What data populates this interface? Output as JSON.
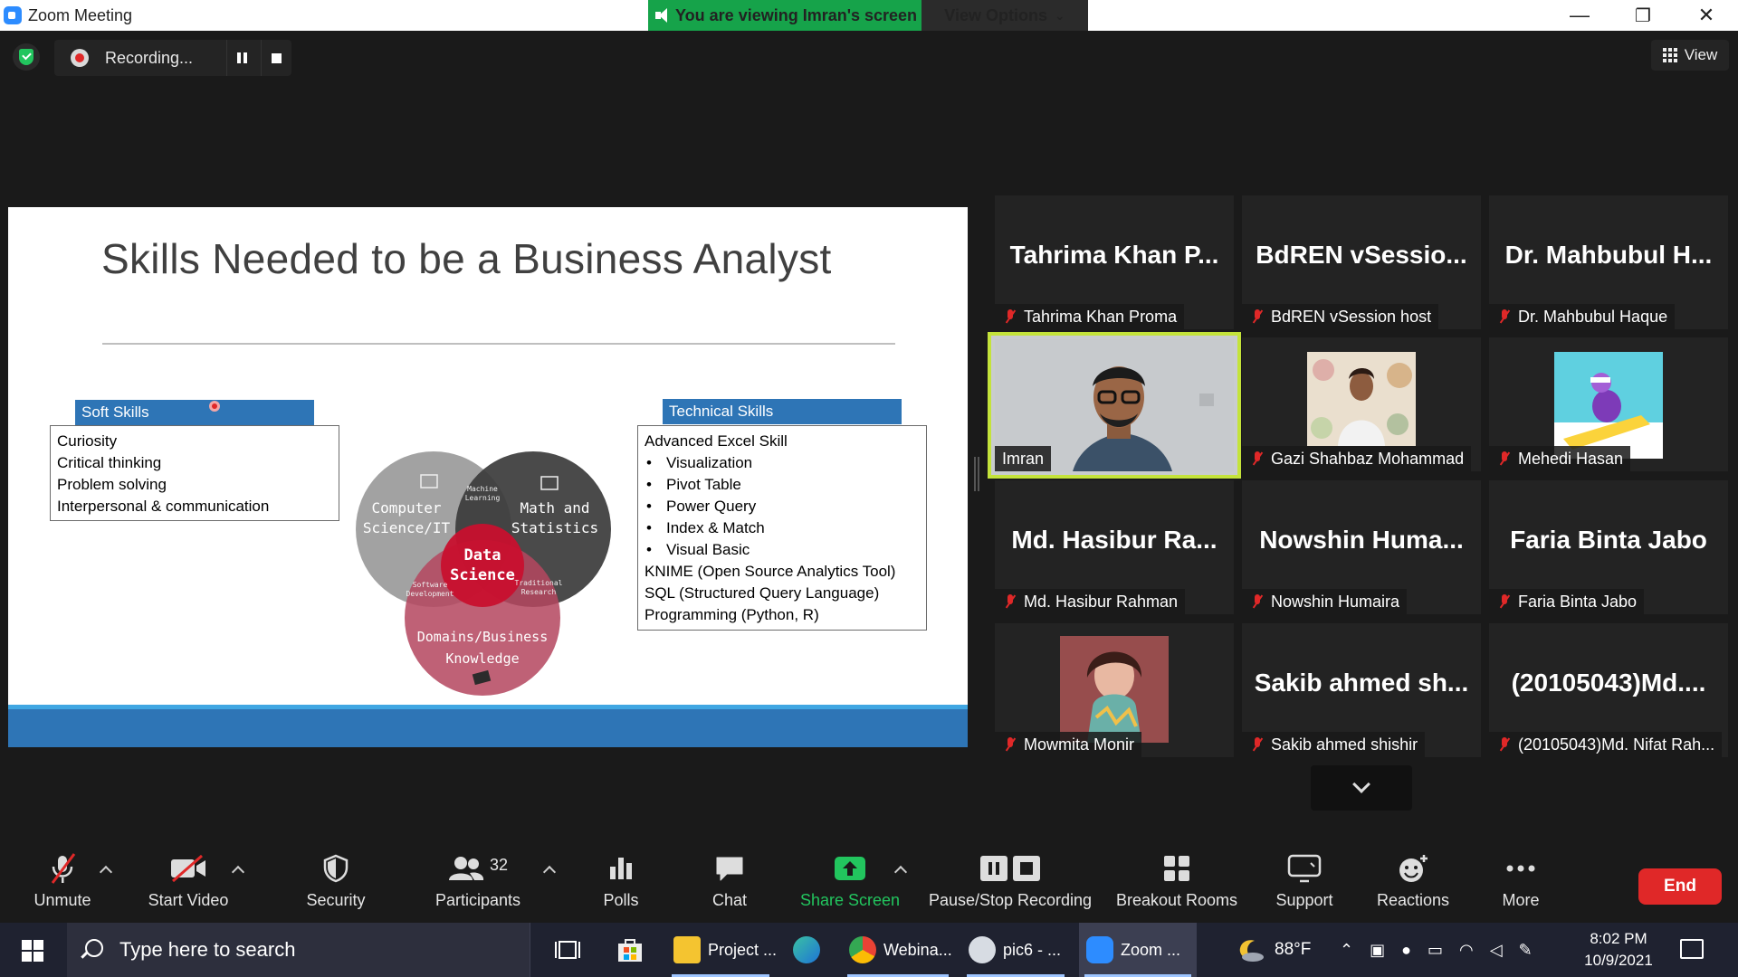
{
  "window": {
    "title": "Zoom Meeting",
    "viewing_banner": "You are viewing Imran's screen",
    "view_options": "View Options",
    "minimize": "—",
    "restore": "❐",
    "close": "✕"
  },
  "recording": {
    "status": "Recording..."
  },
  "view_button": "View",
  "slide": {
    "title": "Skills Needed to be a Business Analyst",
    "soft_skills": {
      "heading": "Soft Skills",
      "items": [
        "Curiosity",
        "Critical thinking",
        "Problem solving",
        "Interpersonal & communication"
      ]
    },
    "technical_skills": {
      "heading": "Technical Skills",
      "items": [
        {
          "text": "Advanced Excel Skill",
          "bullet": false
        },
        {
          "text": "Visualization",
          "bullet": true
        },
        {
          "text": "Pivot Table",
          "bullet": true
        },
        {
          "text": "Power Query",
          "bullet": true
        },
        {
          "text": "Index & Match",
          "bullet": true
        },
        {
          "text": "Visual Basic",
          "bullet": true
        },
        {
          "text": "KNIME (Open Source Analytics Tool)",
          "bullet": false
        },
        {
          "text": "SQL (Structured Query Language)",
          "bullet": false
        },
        {
          "text": "Programming (Python, R)",
          "bullet": false
        }
      ]
    },
    "venn": {
      "cs_line1": "Computer",
      "cs_line2": "Science/IT",
      "math_line1": "Math and",
      "math_line2": "Statistics",
      "domain_line1": "Domains/Business",
      "domain_line2": "Knowledge",
      "center_line1": "Data",
      "center_line2": "Science",
      "ml_line1": "Machine",
      "ml_line2": "Learning",
      "sd_line1": "Software",
      "sd_line2": "Development",
      "tr_line1": "Traditional",
      "tr_line2": "Research",
      "colors": {
        "cs": "#9a9a9a",
        "math": "#3b3b3b",
        "domain": "#b5475f",
        "center": "#c8102e"
      }
    }
  },
  "participants": [
    {
      "tile_name": "Tahrima Khan P...",
      "label": "Tahrima Khan Proma",
      "muted": true
    },
    {
      "tile_name": "BdREN  vSessio...",
      "label": "BdREN vSession host",
      "muted": true
    },
    {
      "tile_name": "Dr. Mahbubul H...",
      "label": "Dr. Mahbubul Haque",
      "muted": true
    },
    {
      "tile_name": "",
      "label": "Imran",
      "muted": false,
      "video": true
    },
    {
      "tile_name": "",
      "label": "Gazi Shahbaz Mohammad",
      "muted": true,
      "photo": true
    },
    {
      "tile_name": "",
      "label": "Mehedi Hasan",
      "muted": true,
      "photo": true
    },
    {
      "tile_name": "Md. Hasibur Ra...",
      "label": "Md. Hasibur Rahman",
      "muted": true
    },
    {
      "tile_name": "Nowshin  Huma...",
      "label": "Nowshin  Humaira",
      "muted": true
    },
    {
      "tile_name": "Faria Binta Jabo",
      "label": "Faria Binta Jabo",
      "muted": true
    },
    {
      "tile_name": "",
      "label": "Mowmita Monir",
      "muted": true,
      "photo": true
    },
    {
      "tile_name": "Sakib ahmed sh...",
      "label": "Sakib ahmed shishir",
      "muted": true
    },
    {
      "tile_name": "(20105043)Md....",
      "label": "(20105043)Md. Nifat Rah...",
      "muted": true
    }
  ],
  "toolbar": {
    "unmute": "Unmute",
    "start_video": "Start Video",
    "security": "Security",
    "participants": "Participants",
    "participants_count": "32",
    "polls": "Polls",
    "chat": "Chat",
    "share_screen": "Share Screen",
    "pause_stop_recording": "Pause/Stop Recording",
    "breakout_rooms": "Breakout Rooms",
    "support": "Support",
    "reactions": "Reactions",
    "more": "More",
    "end": "End"
  },
  "taskbar": {
    "search_placeholder": "Type here to search",
    "apps": [
      {
        "label": "Project ...",
        "icon": "file-explorer-icon"
      },
      {
        "label": "Webina...",
        "icon": "chrome-icon"
      },
      {
        "label": "pic6 - ...",
        "icon": "paint-icon"
      },
      {
        "label": "Zoom ...",
        "icon": "zoom-icon"
      }
    ],
    "weather": "88°F",
    "time": "8:02 PM",
    "date": "10/9/2021"
  }
}
